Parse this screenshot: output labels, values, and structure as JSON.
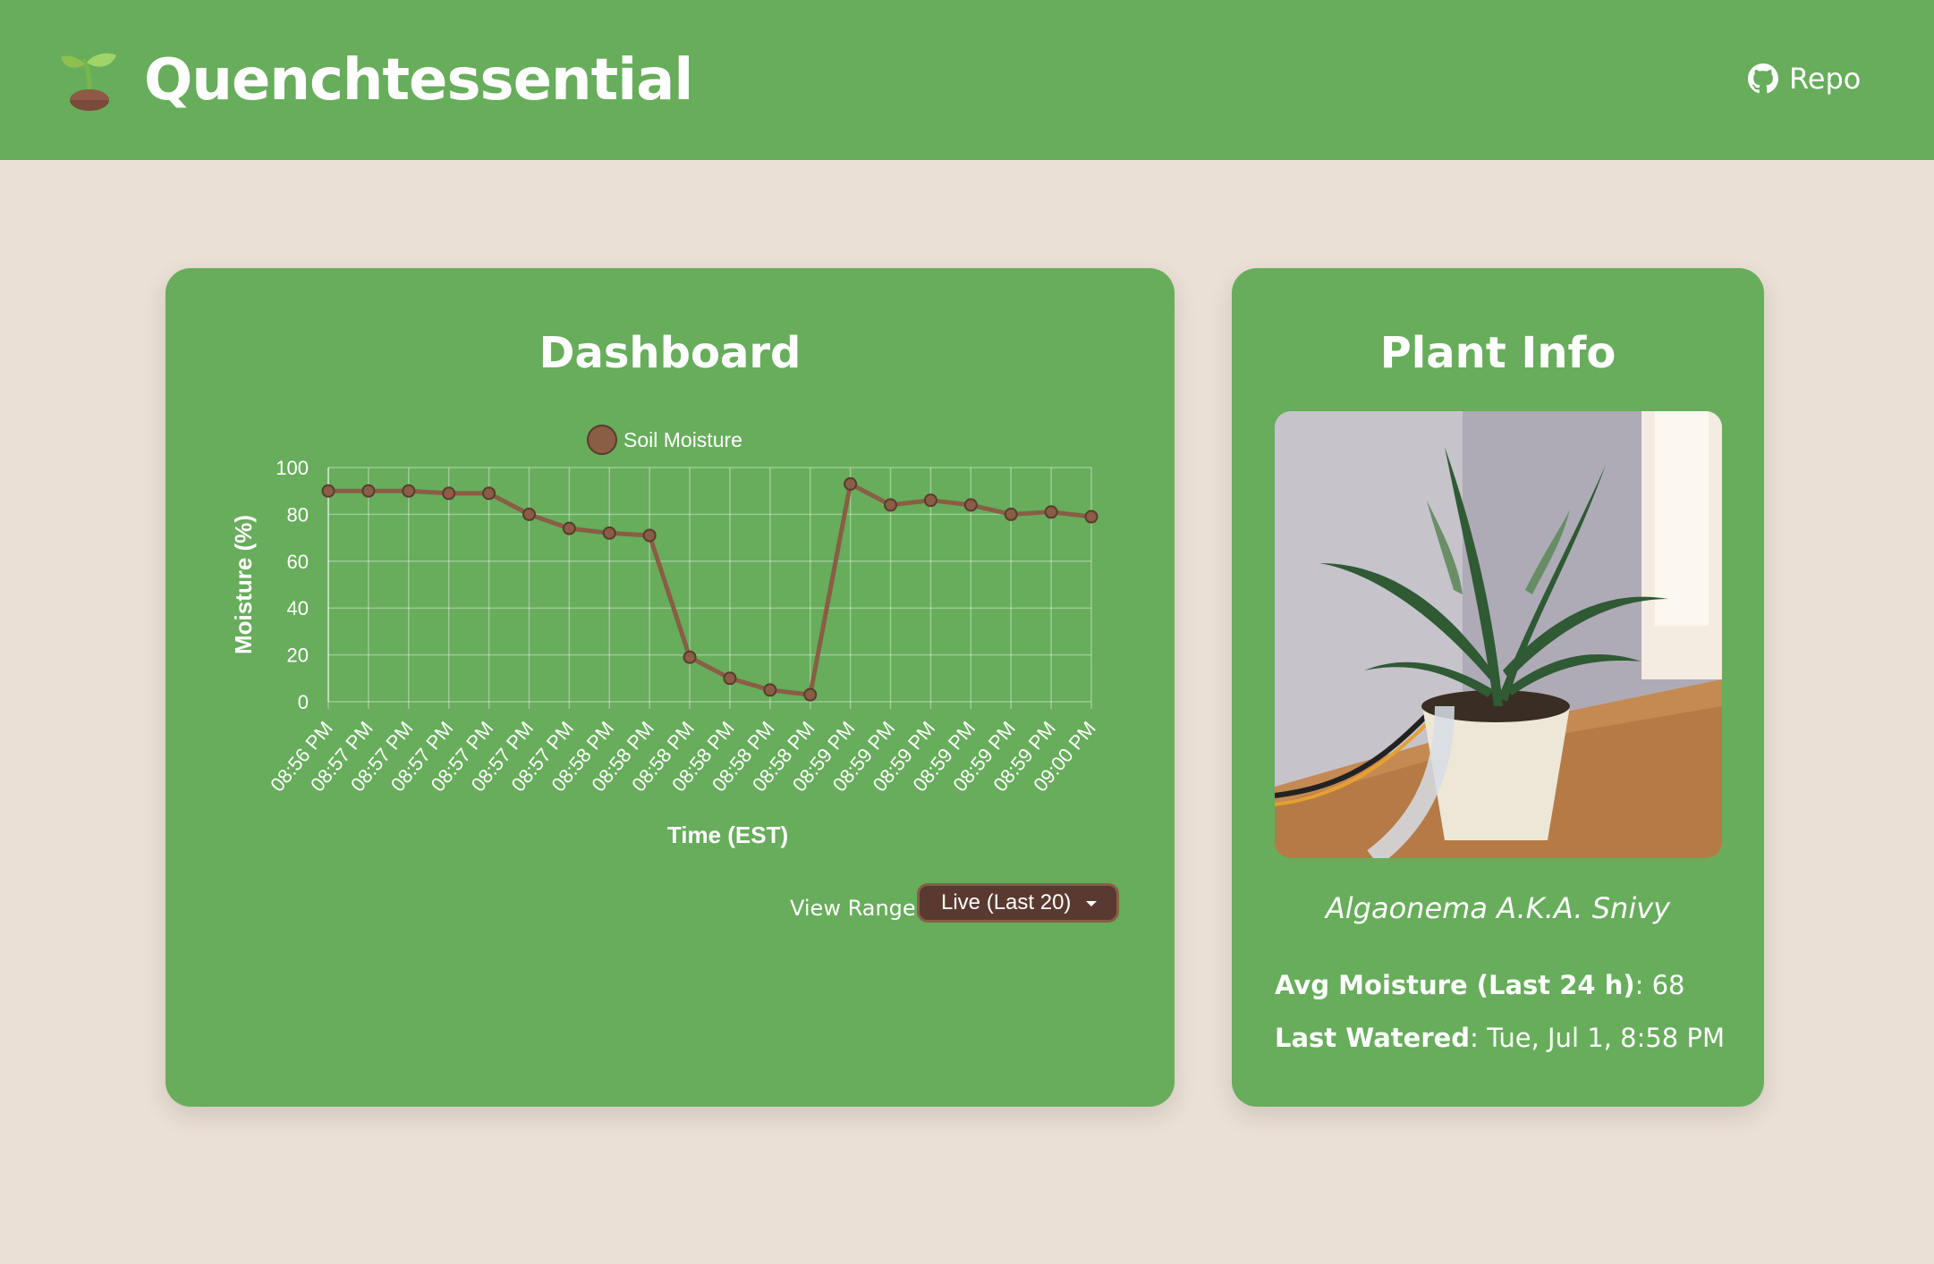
{
  "header": {
    "title": "Quenchtessential",
    "logo_icon": "seedling-icon",
    "repo_label": "Repo",
    "repo_icon": "github-icon"
  },
  "dashboard": {
    "title": "Dashboard",
    "view_range_label": "View Range:",
    "view_range_value": "Live (Last 20)"
  },
  "plant_info": {
    "title": "Plant Info",
    "name": "Algaonema A.K.A. Snivy",
    "avg_moisture_label": "Avg Moisture (Last 24 h)",
    "avg_moisture_value": "68",
    "last_watered_label": "Last Watered",
    "last_watered_value": "Tue, Jul 1, 8:58 PM"
  },
  "colors": {
    "brand_green": "#67ad5b",
    "background": "#ebe0d6",
    "series_brown": "#8a5d45",
    "dropdown_bg": "#5a3a30"
  },
  "chart_data": {
    "type": "line",
    "title": "",
    "legend_position": "top",
    "xlabel": "Time (EST)",
    "ylabel": "Moisture (%)",
    "ylim": [
      0,
      100
    ],
    "yticks": [
      0,
      20,
      40,
      60,
      80,
      100
    ],
    "grid": true,
    "categories": [
      "08:56 PM",
      "08:57 PM",
      "08:57 PM",
      "08:57 PM",
      "08:57 PM",
      "08:57 PM",
      "08:57 PM",
      "08:58 PM",
      "08:58 PM",
      "08:58 PM",
      "08:58 PM",
      "08:58 PM",
      "08:58 PM",
      "08:59 PM",
      "08:59 PM",
      "08:59 PM",
      "08:59 PM",
      "08:59 PM",
      "08:59 PM",
      "09:00 PM"
    ],
    "series": [
      {
        "name": "Soil Moisture",
        "values": [
          90,
          90,
          90,
          89,
          89,
          80,
          74,
          72,
          71,
          19,
          10,
          5,
          3,
          93,
          84,
          86,
          84,
          80,
          81,
          79
        ]
      }
    ]
  }
}
